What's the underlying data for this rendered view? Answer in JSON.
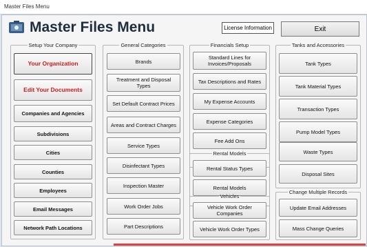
{
  "window": {
    "title": "Master Files Menu"
  },
  "header": {
    "title": "Master Files Menu",
    "license_label": "License Information",
    "exit_label": "Exit"
  },
  "groups": {
    "setup": {
      "legend": "Setup Your Company",
      "buttons": [
        "Your Organization",
        "Edit Your Documents",
        "Companies and Agencies",
        "Subdivisions",
        "Cities",
        "Counties",
        "Employees",
        "Email Messages",
        "Network Path Locations"
      ]
    },
    "general": {
      "legend": "General Categories",
      "buttons": [
        "Brands",
        "Treatment and Disposal Types",
        "Set Default Contract Prices",
        "Areas and Contract Charges",
        "Service Types",
        "Disinfectant Types",
        "Inspection Master",
        "Work Order Jobs",
        "Part Descriptions"
      ]
    },
    "financials": {
      "legend": "Financials Setup",
      "buttons": [
        "Standard Lines for Invoices/Proposals",
        "Tax Descriptions and Rates",
        "My Expense Accounts",
        "Expense Categories",
        "Fee Add Ons"
      ]
    },
    "rental": {
      "legend": "Rental Models",
      "buttons": [
        "Rental Status Types",
        "Rental Models"
      ]
    },
    "vehicles": {
      "legend": "Vehicles",
      "buttons": [
        "Vehicle Work Order Companies",
        "Vehicle Work Order Types"
      ]
    },
    "tanks": {
      "legend": "Tanks and Accessories",
      "buttons": [
        "Tank Types",
        "Tank Material Types",
        "Transaction Types",
        "Pump Model Types",
        "Waste Types",
        "Disposal Sites"
      ]
    },
    "change": {
      "legend": "Change Multiple Records",
      "buttons": [
        "Update Email Addresses",
        "Mass Change Queries"
      ]
    }
  },
  "colors": {
    "accent_red": "#cc1a1a",
    "title_color": "#1e2d3d"
  }
}
